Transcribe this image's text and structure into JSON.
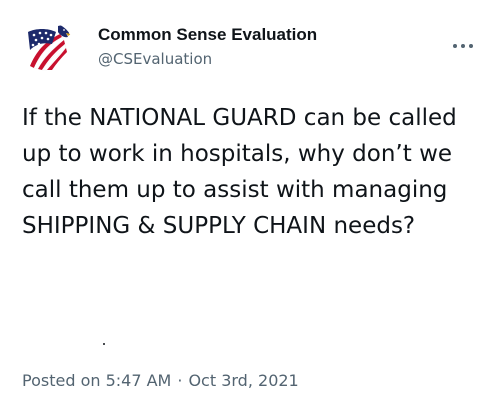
{
  "tweet": {
    "author": {
      "display_name": "Common Sense Evaluation",
      "handle": "@CSEvaluation",
      "avatar_icon": "american-flag-eagle-logo"
    },
    "more_icon": "ellipsis-icon",
    "text": "If the NATIONAL GUARD can be called up to work in hospitals, why don’t we call them up to assist with managing SHIPPING & SUPPLY CHAIN needs?",
    "posted_prefix": "Posted on",
    "time": "5:47 AM",
    "separator": "·",
    "date": "Oct 3rd, 2021"
  },
  "colors": {
    "text_primary": "#0f1419",
    "text_secondary": "#536471",
    "flag_red": "#c8102e",
    "flag_navy": "#1d2a6b"
  }
}
